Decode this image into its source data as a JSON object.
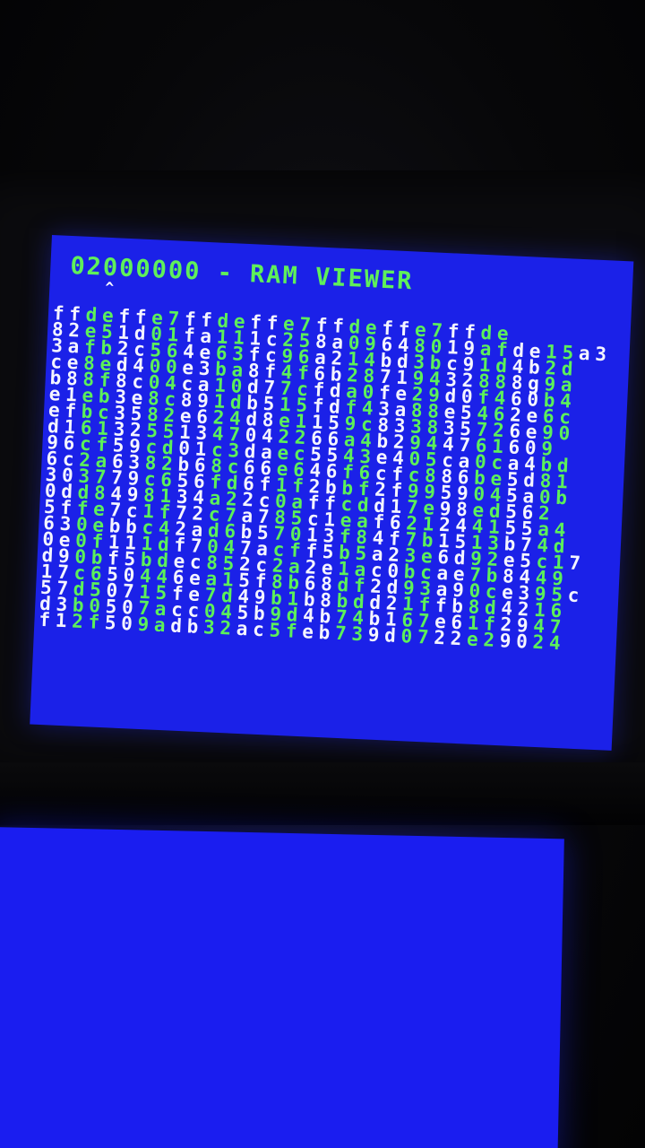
{
  "top_screen": {
    "address": "02000000",
    "title": " - RAM VIEWER",
    "cursor": "^",
    "hex_rows": [
      "ffdeffe7ffdeffe7ffdeffe7ffde",
      "82e51d01fa111c258a09648019afde15a3",
      "3afb2c564e63fc96a214bd3bc91d4b2d",
      "ce8ed400e3ba8f4f6b28719432888g9a",
      "b88f8c04ca10d77cfda0fe29d0f460b4",
      "e1eb3e8c891db515fdf43a88e5462e6c",
      "efbc3582e624d8e1159c833835726e90",
      "d16132551347042266a4b2944761609",
      "96cf59cd01c3daec5543e405ca0ca4bd",
      "6c2a6382b68c66e646f6cfc886be5d81",
      "303779c656fd6f1f2bbf2f9959045a0b",
      "0dd8498134a22c0affcdd17e98ed562",
      "5ffe7c1f72c7a785c1eaf621244155a4",
      "630ebbc42ad6b57013f84f7b1513b74d",
      "0e0f111df7047acff5b5a23e6d92e5c17",
      "d90bf5bdec852c2a2e1ac0bcae7b8449",
      "17c650446ea15f8b68df2d93a90ce395c",
      "57d50715fe7d49b1b8bdd21ffb8d4216",
      "d3b0507acc045b9d4b74b167e61f2947",
      "f12f509adb32ac5feb739d0722e29024"
    ]
  },
  "colors": {
    "screen_blue": "#1b21e8",
    "text_white": "#f4f4ff",
    "text_green": "#5cf05a"
  }
}
